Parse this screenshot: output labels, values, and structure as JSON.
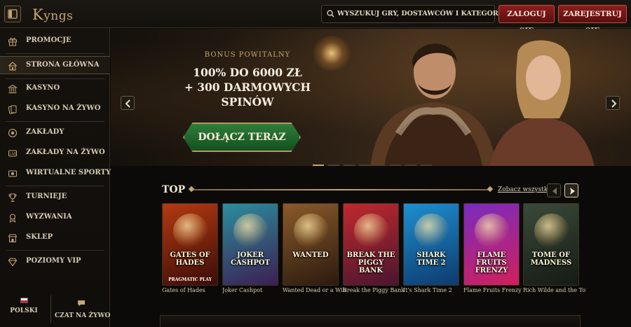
{
  "header": {
    "logo": "KYNGS",
    "search_placeholder": "WYSZUKUJ GRY, DOSTAWCÓW I KATEGORIE",
    "login_label": "ZALOGUJ SIĘ",
    "register_label": "ZAREJESTRUJ SIĘ"
  },
  "sidebar": {
    "items": [
      {
        "label": "PROMOCJE",
        "icon": "gift-icon"
      },
      {
        "label": "STRONA GŁÓWNA",
        "icon": "home-icon"
      },
      {
        "label": "KASYNO",
        "icon": "casino-icon"
      },
      {
        "label": "KASYNO NA ŻYWO",
        "icon": "cards-icon"
      },
      {
        "label": "ZAKŁADY",
        "icon": "football-icon"
      },
      {
        "label": "ZAKŁADY NA ŻYWO",
        "icon": "live-icon"
      },
      {
        "label": "WIRTUALNE SPORTY",
        "icon": "virtual-icon"
      },
      {
        "label": "TURNIEJE",
        "icon": "trophy-icon"
      },
      {
        "label": "WYZWANIA",
        "icon": "challenge-icon"
      },
      {
        "label": "SKLEP",
        "icon": "shop-icon"
      },
      {
        "label": "POZIOMY VIP",
        "icon": "diamond-icon"
      }
    ],
    "active_index": 1,
    "language_label": "POLSKI",
    "chat_label": "CZAT NA ŻYWO"
  },
  "hero": {
    "subtitle": "BONUS POWITALNY",
    "title_line1": "100% DO 6000 ZŁ",
    "title_line2": "+ 300 DARMOWYCH",
    "title_line3": "SPINÓW",
    "cta_label": "DOŁĄCZ TERAZ",
    "slide_count": 8,
    "active_slide": 0
  },
  "games_section": {
    "title": "TOP",
    "see_all_label": "Zobacz wszystko",
    "games": [
      {
        "name": "Gates of Hades",
        "thumb_text": "GATES OF HADES",
        "brand": "PRAGMATIC PLAY",
        "color_a": "#b33a12",
        "color_b": "#3a0c07"
      },
      {
        "name": "Joker Cashpot",
        "thumb_text": "JOKER CASHPOT",
        "brand": "",
        "color_a": "#2b8d9e",
        "color_b": "#3b1f52"
      },
      {
        "name": "Wanted Dead or a Wild",
        "thumb_text": "WANTED",
        "brand": "",
        "color_a": "#8a5a2a",
        "color_b": "#2b1a0f"
      },
      {
        "name": "Break the Piggy Bank",
        "thumb_text": "BREAK THE PIGGY BANK",
        "brand": "",
        "color_a": "#c0292e",
        "color_b": "#4a1530"
      },
      {
        "name": "It's Shark Time 2",
        "thumb_text": "SHARK TIME 2",
        "brand": "",
        "color_a": "#1d8fd0",
        "color_b": "#0d3a6e"
      },
      {
        "name": "Flame Fruits Frenzy",
        "thumb_text": "FLAME FRUITS FRENZY",
        "brand": "",
        "color_a": "#7a2bbf",
        "color_b": "#d0205a"
      },
      {
        "name": "Rich Wilde and the Tome of Madness",
        "thumb_text": "TOME OF MADNESS",
        "brand": "",
        "color_a": "#3a4a3a",
        "color_b": "#141a14"
      }
    ]
  }
}
